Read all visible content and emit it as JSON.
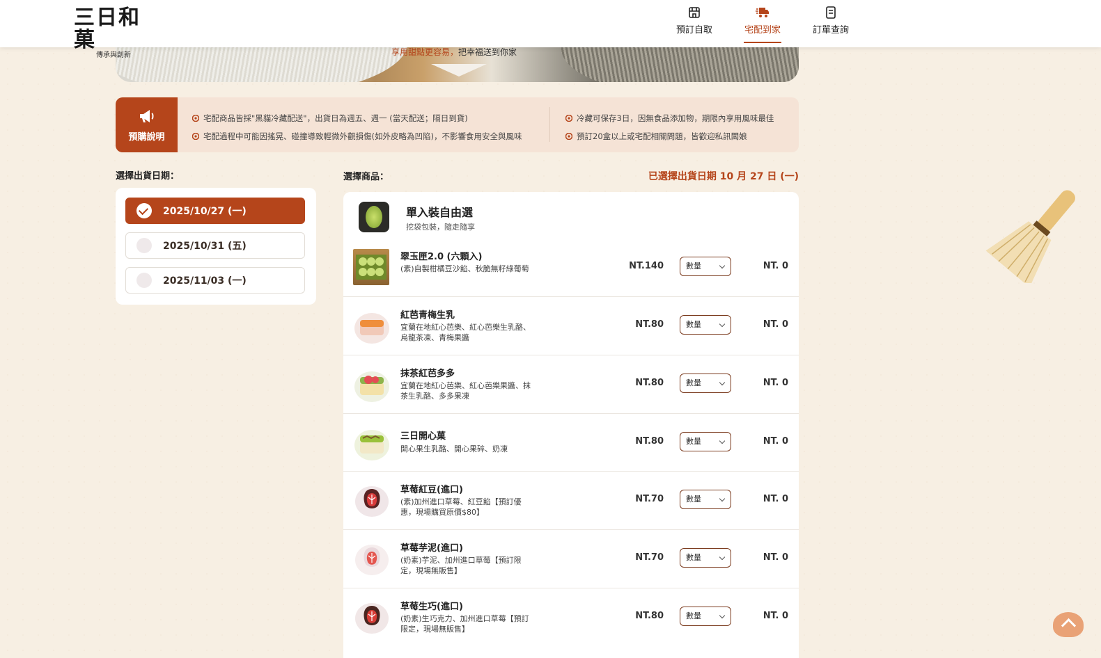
{
  "brand": {
    "name": "三日和菓",
    "tagline": "傳承與創新"
  },
  "nav": [
    {
      "label": "預訂自取",
      "icon": "store-icon",
      "active": false
    },
    {
      "label": "宅配到家",
      "icon": "delivery-truck-icon",
      "active": true
    },
    {
      "label": "訂單查詢",
      "icon": "receipt-icon",
      "active": false
    }
  ],
  "banner": {
    "highlight": "享用甜點更容易，",
    "text": "把幸福送到你家"
  },
  "notice": {
    "tag": "預購說明",
    "left": [
      "宅配商品皆採\"黑貓冷藏配送\"，出貨日為週五、週一 (當天配送；隔日到貨)",
      "宅配過程中可能因搖晃、碰撞導致輕微外觀損傷(如外皮略為凹陷)，不影響食用安全與風味"
    ],
    "right": [
      "冷藏可保存3日，因無食品添加物，期限內享用風味最佳",
      "預訂20盒以上或宅配相關問題，皆歡迎私訊闆娘"
    ]
  },
  "date_section": {
    "title": "選擇出貨日期：",
    "options": [
      {
        "label": "2025/10/27 (一)",
        "selected": true
      },
      {
        "label": "2025/10/31 (五)",
        "selected": false
      },
      {
        "label": "2025/11/03 (一)",
        "selected": false
      }
    ]
  },
  "product_section": {
    "title": "選擇商品：",
    "selected_info": "已選擇出貨日期 10 月 27 日 (一)",
    "category": {
      "name": "單入裝自由選",
      "desc": "挖袋包裝，隨走隨享"
    },
    "select_placeholder": "數量",
    "items": [
      {
        "name": "翠玉匣2.0 (六顆入)",
        "desc": "(素)自製柑橘豆沙餡、秋脆無籽綠葡萄",
        "price": "NT.140",
        "subtotal": "NT. 0"
      },
      {
        "name": "紅芭青梅生乳",
        "desc": "宜蘭在地紅心芭樂、紅心芭樂生乳酪、烏龍茶凍、青梅果醬",
        "price": "NT.80",
        "subtotal": "NT. 0"
      },
      {
        "name": "抹茶紅芭多多",
        "desc": "宜蘭在地紅心芭樂、紅心芭樂果醬、抹茶生乳酪、多多果凍",
        "price": "NT.80",
        "subtotal": "NT. 0"
      },
      {
        "name": "三日開心菓",
        "desc": "開心果生乳酪、開心果碎、奶凍",
        "price": "NT.80",
        "subtotal": "NT. 0"
      },
      {
        "name": "草莓紅豆(進口)",
        "desc": "(素)加州進口草莓、紅豆餡【預訂優惠，現場購買原價$80】",
        "price": "NT.70",
        "subtotal": "NT. 0"
      },
      {
        "name": "草莓芋泥(進口)",
        "desc": "(奶素)芋泥、加州進口草莓【預訂限定，現場無販售】",
        "price": "NT.70",
        "subtotal": "NT. 0"
      },
      {
        "name": "草莓生巧(進口)",
        "desc": "(奶素)生巧克力、加州進口草莓【預訂限定，現場無販售】",
        "price": "NT.80",
        "subtotal": "NT. 0"
      }
    ]
  },
  "colors": {
    "accent": "#b5451b",
    "notice_bg": "#f5e3d6",
    "page_bg": "#f7efe3"
  }
}
